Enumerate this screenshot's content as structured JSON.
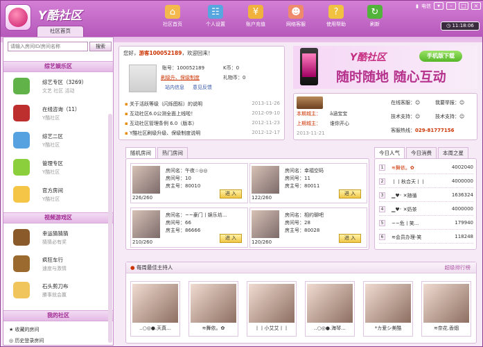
{
  "app": {
    "title": "Y酷社区",
    "home_tab": "社区首页"
  },
  "nav": [
    {
      "label": "社区首页",
      "icon": "home-icon",
      "color": "#f3b94d"
    },
    {
      "label": "个人设置",
      "icon": "settings-icon",
      "color": "#56a6df"
    },
    {
      "label": "账户充值",
      "icon": "wallet-icon",
      "color": "#f0b23c"
    },
    {
      "label": "网络客服",
      "icon": "support-icon",
      "color": "#ef8b6d"
    },
    {
      "label": "使用帮助",
      "icon": "help-icon",
      "color": "#f1c241"
    },
    {
      "label": "刷新",
      "icon": "refresh-icon",
      "color": "#52b33a"
    }
  ],
  "system": {
    "network": "电信",
    "time": "11:18:06"
  },
  "search": {
    "placeholder": "请输入房间ID/房间名称",
    "button": "搜索"
  },
  "sidebar": {
    "categories": [
      "综艺娱乐区",
      "视频游戏区",
      "我的社区"
    ],
    "rooms": [
      {
        "name": "综艺专区（3269）",
        "sub": "文艺 社区 活动",
        "icon": "tree-icon",
        "color": "#62b24a"
      },
      {
        "name": "在线咨询（11）",
        "sub": "Y酷社区",
        "icon": "bird-icon",
        "color": "#bd2e2e"
      },
      {
        "name": "综艺二区",
        "sub": "Y酷社区",
        "icon": "palette-icon",
        "color": "#56a2e0"
      },
      {
        "name": "管理专区",
        "sub": "Y酷社区",
        "icon": "shield-icon",
        "color": "#8bcf3c"
      },
      {
        "name": "官方房间",
        "sub": "Y酷社区",
        "icon": "box-icon",
        "color": "#f4c547"
      },
      {
        "name": "幸运猜猜猜",
        "sub": "猜猜必有奖",
        "icon": "game-icon",
        "color": "#8b5a2b"
      },
      {
        "name": "疯狂车行",
        "sub": "速度与激情",
        "icon": "car-icon",
        "color": "#9a6a2e"
      },
      {
        "name": "石头剪刀布",
        "sub": "勝事就会赢",
        "icon": "hand-icon",
        "color": "#f0c55b"
      }
    ],
    "links": [
      "收藏的房间",
      "历史登录房间"
    ]
  },
  "account": {
    "greeting_prefix": "您好，",
    "guest": "游客100052189",
    "greeting_suffix": "，欢迎回来！",
    "id_label": "账号：",
    "id": "100052189",
    "k_label": "K币：",
    "k_value": "0",
    "upgrade": "刷级升、保级制度",
    "gift_label": "礼物币：",
    "gift_value": "0",
    "inbox": "站内信息",
    "feedback": "意见反馈"
  },
  "news": [
    {
      "title": "关于活跃等级（闪烁图标）的说明",
      "date": "2013-11-26"
    },
    {
      "title": "互动社区6.0公测全面上线啦！",
      "date": "2012-09-10"
    },
    {
      "title": "互动社区管理条例 6.0（版本）",
      "date": "2012-11-23"
    },
    {
      "title": "Y酷社区刷级升级、保级制度说明",
      "date": "2012-12-17"
    }
  ],
  "banner": {
    "title": "Y酷社区",
    "subtitle": "随时随地 随心互动",
    "download": "手机版下载"
  },
  "masters": {
    "current_label": "本期城主：",
    "current_name": "ā涵宝宝",
    "next_label": "上期城主：",
    "next_name": "谁你开心",
    "date": "2013-11-21",
    "support_online": "在线客服：",
    "support_report": "我要举报：",
    "tech_support": "技术支持：",
    "tech_team": "技术支持：",
    "hotline_label": "客服热线：",
    "hotline": "029-81777156"
  },
  "room_tabs": {
    "random": "随机房间",
    "hot": "热门房间"
  },
  "room_cards": [
    {
      "name": "午夜☆◎◎",
      "id": "10",
      "host": "80010",
      "count": "226/260",
      "enter": "进 入"
    },
    {
      "name": "幸福空码",
      "id": "11",
      "host": "80011",
      "count": "122/260",
      "enter": "进 入"
    },
    {
      "name": "~~豪门丨娱乐坊...",
      "id": "66",
      "host": "86666",
      "count": "210/260",
      "enter": "进 入"
    },
    {
      "name": "相约聊吧",
      "id": "28",
      "host": "80028",
      "count": "120/260",
      "enter": "进 入"
    }
  ],
  "room_labels": {
    "name": "房间名：",
    "id": "房间号：",
    "host": "房主号："
  },
  "rank_tabs": [
    "今日人气",
    "今日消费",
    "本周之星"
  ],
  "ranks": [
    {
      "no": "1",
      "name": "≋舞依。✿",
      "value": "4002040"
    },
    {
      "no": "2",
      "name": "丨丨秋合天丨丨",
      "value": "4000000"
    },
    {
      "no": "3",
      "name": "▁♥ᵕ ✕随循",
      "value": "1636324"
    },
    {
      "no": "4",
      "name": "▁♥ᵕ ✕奶茶",
      "value": "4000000"
    },
    {
      "no": "5",
      "name": "~~危丨笑...",
      "value": "179940"
    },
    {
      "no": "6",
      "name": "≋会员办理-笑",
      "value": "118248"
    }
  ],
  "weekly": {
    "title": "每周最佳主持人",
    "more": "超级排行榜"
  },
  "hosts": [
    "..○◎●.天真...",
    "≋舞依。✿",
    "丨丨小艾艾丨丨",
    "..○◎●.海琴...",
    "*カ爱シ美酷",
    "≋奈花.香烟"
  ]
}
